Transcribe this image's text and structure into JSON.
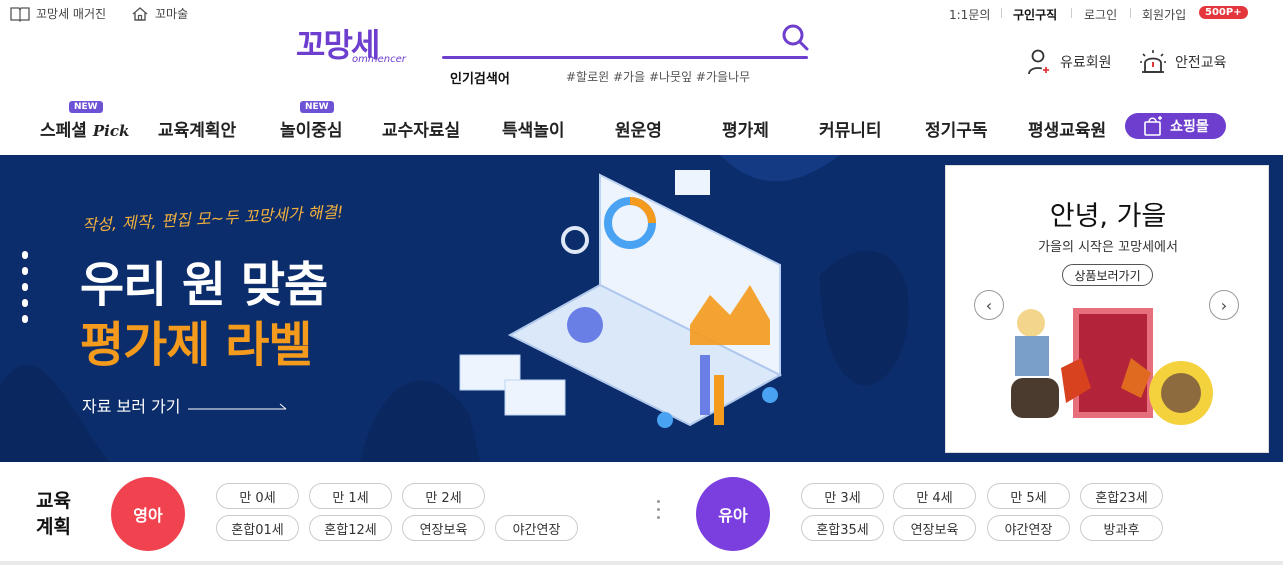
{
  "topbar": {
    "magazine": "꼬망세 매거진",
    "komasul": "꼬마술",
    "inquiry": "1:1문의",
    "jobs": "구인구직",
    "login": "로그인",
    "signup": "회원가입",
    "signup_badge": "500P+"
  },
  "logo": {
    "main": "꼬망세",
    "sub": "ommencer"
  },
  "search": {
    "popular_label": "인기검색어",
    "popular_tags": "#할로윈 #가을 #나뭇잎 #가을나무"
  },
  "util": {
    "paid_member": "유료회원",
    "safety": "안전교육"
  },
  "nav": {
    "items": [
      {
        "label": "스페셜 ",
        "suffix": "Pick",
        "new": "NEW"
      },
      {
        "label": "교육계획안"
      },
      {
        "label": "놀이중심",
        "new": "NEW"
      },
      {
        "label": "교수자료실"
      },
      {
        "label": "특색놀이"
      },
      {
        "label": "원운영"
      },
      {
        "label": "평가제"
      },
      {
        "label": "커뮤니티"
      },
      {
        "label": "정기구독"
      },
      {
        "label": "평생교육원"
      }
    ],
    "shop": "쇼핑몰"
  },
  "banner": {
    "small": "작성, 제작, 편집 모~두 꼬망세가 해결!",
    "title1": "우리 원 맞춤",
    "title2": "평가제 라벨",
    "link": "자료 보러 가기",
    "bg_color": "#0c2d6b",
    "accent_color": "#f49a1c"
  },
  "card": {
    "title": "안녕, 가을",
    "subtitle": "가을의 시작은 꼬망세에서",
    "button": "상품보러가기",
    "prev_icon": "chevron-left-icon",
    "next_icon": "chevron-right-icon"
  },
  "plan": {
    "label_line1": "교육",
    "label_line2": "계획",
    "infant": {
      "label": "영아",
      "color": "#f0434f",
      "row1": [
        "만 0세",
        "만 1세",
        "만 2세"
      ],
      "row2": [
        "혼합01세",
        "혼합12세",
        "연장보육",
        "야간연장"
      ]
    },
    "child": {
      "label": "유아",
      "color": "#7b3fe0",
      "row1": [
        "만 3세",
        "만 4세",
        "만 5세",
        "혼합23세"
      ],
      "row2": [
        "혼합35세",
        "연장보육",
        "야간연장",
        "방과후"
      ]
    }
  }
}
